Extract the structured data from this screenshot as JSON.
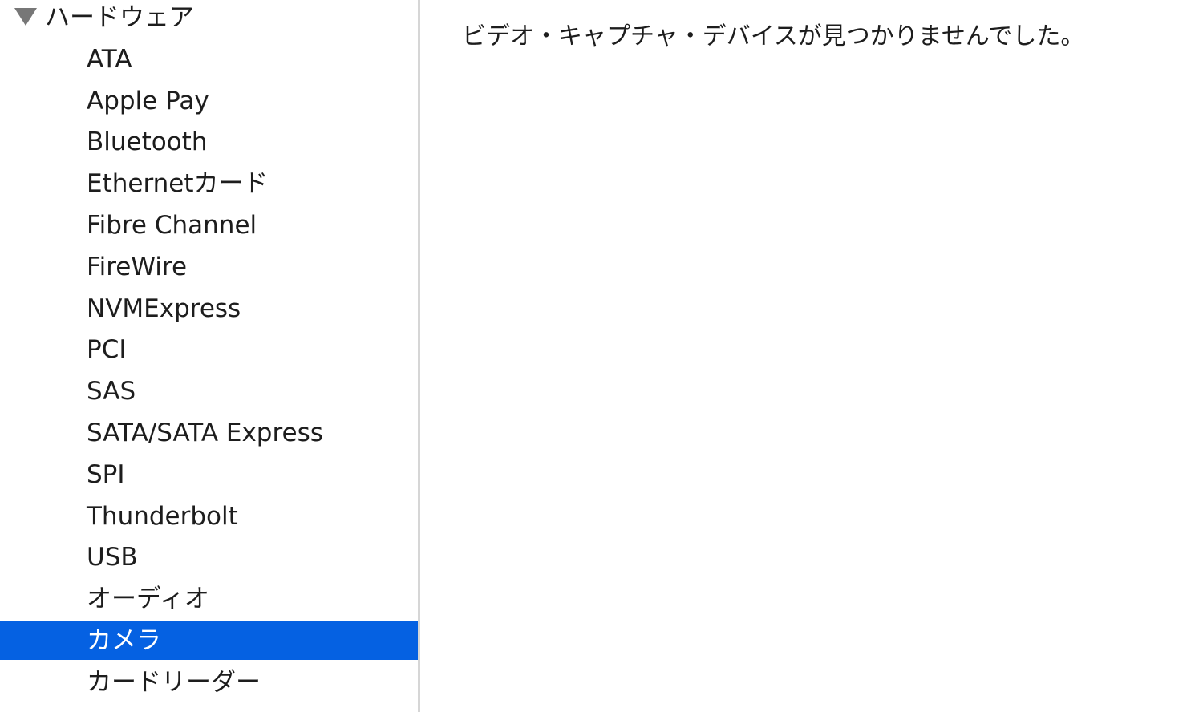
{
  "sidebar": {
    "section": {
      "label": "ハードウェア",
      "expanded": true,
      "icon": "disclosure-triangle-down-icon"
    },
    "items": [
      {
        "label": "ATA"
      },
      {
        "label": "Apple Pay"
      },
      {
        "label": "Bluetooth"
      },
      {
        "label": "Ethernetカード"
      },
      {
        "label": "Fibre Channel"
      },
      {
        "label": "FireWire"
      },
      {
        "label": "NVMExpress"
      },
      {
        "label": "PCI"
      },
      {
        "label": "SAS"
      },
      {
        "label": "SATA/SATA Express"
      },
      {
        "label": "SPI"
      },
      {
        "label": "Thunderbolt"
      },
      {
        "label": "USB"
      },
      {
        "label": "オーディオ"
      },
      {
        "label": "カメラ",
        "selected": true
      },
      {
        "label": "カードリーダー"
      }
    ]
  },
  "content": {
    "message": "ビデオ・キャプチャ・デバイスが見つかりませんでした。"
  },
  "colors": {
    "selection": "#0561e2",
    "divider": "#d6d6d6"
  }
}
